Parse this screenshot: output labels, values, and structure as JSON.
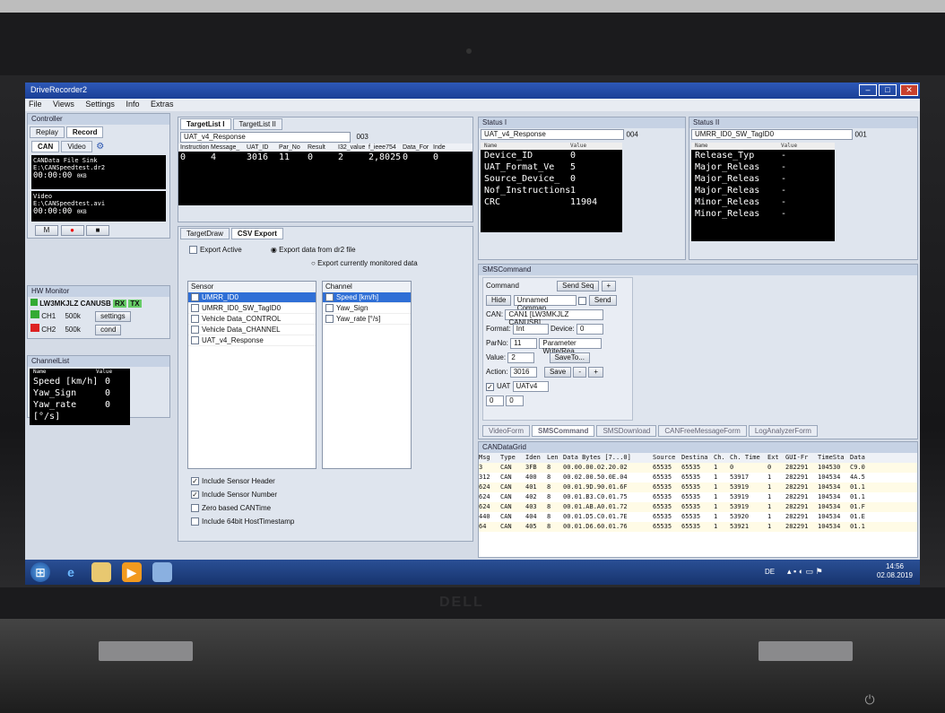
{
  "window": {
    "title": "DriveRecorder2",
    "menu": [
      "File",
      "Views",
      "Settings",
      "Info",
      "Extras"
    ]
  },
  "controller": {
    "header": "Controller",
    "tabs": [
      "Replay",
      "Record"
    ],
    "subtabs": [
      "CAN",
      "Video"
    ],
    "can_file": "CANData File Sink",
    "can_path": "E:\\CANSpeedtest.dr2",
    "can_time": "00:00:00",
    "can_size": "0KB",
    "video_label": "Video",
    "video_path": "E:\\CANSpeedtest.avi",
    "video_time": "00:00:00",
    "video_size": "0KB",
    "toggle_label": "on",
    "mark_label": "M"
  },
  "hw_monitor": {
    "header": "HW Monitor",
    "device": "LW3MKJLZ CANUSB",
    "rx": "RX",
    "tx": "TX",
    "channels": [
      {
        "name": "CH1",
        "rate": "500k",
        "btn": "settings"
      },
      {
        "name": "CH2",
        "rate": "500k",
        "btn": "cond"
      }
    ]
  },
  "channel_list": {
    "header": "ChannelList",
    "col_name": "Name",
    "col_value": "Value",
    "rows": [
      {
        "name": "Speed [km/h]",
        "value": "0"
      },
      {
        "name": "Yaw_Sign",
        "value": "0"
      },
      {
        "name": "Yaw_rate [°/s]",
        "value": "0"
      }
    ]
  },
  "targetlist": {
    "tabs": [
      "TargetList I",
      "TargetList II"
    ],
    "selector": "UAT_v4_Response",
    "count": "003",
    "columns": [
      "Instruction",
      "Message_",
      "UAT_ID",
      "Par_No",
      "Result",
      "I32_value",
      "f_ieee754",
      "Data_For",
      "Inde"
    ],
    "row": [
      "0",
      "4",
      "3016",
      "11",
      "0",
      "2",
      "2,8025",
      "0",
      "0"
    ]
  },
  "lower_tabs": {
    "tabs": [
      "TargetDraw",
      "CSV Export"
    ],
    "export_active": "Export Active",
    "radio1": "Export data from dr2 file",
    "radio2": "Export currently monitored data",
    "sensor_header": "Sensor",
    "channel_header": "Channel",
    "sensors": [
      "UMRR_ID0",
      "UMRR_ID0_SW_TagID0",
      "Vehicle Data_CONTROL",
      "Vehicle Data_CHANNEL",
      "UAT_v4_Response"
    ],
    "channels": [
      "Speed [km/h]",
      "Yaw_Sign",
      "Yaw_rate [°/s]"
    ],
    "options": [
      "Include Sensor Header",
      "Include Sensor Number",
      "Zero based CANTime",
      "Include 64bit HostTimestamp"
    ]
  },
  "status1": {
    "header": "Status I",
    "selector": "UAT_v4_Response",
    "count": "004",
    "col_name": "Name",
    "col_value": "Value",
    "rows": [
      {
        "name": "Device_ID",
        "value": "0"
      },
      {
        "name": "UAT_Format_Ve",
        "value": "5"
      },
      {
        "name": "Source_Device_",
        "value": "0"
      },
      {
        "name": "Nof_Instructions",
        "value": "1"
      },
      {
        "name": "CRC",
        "value": "11904"
      }
    ]
  },
  "status2": {
    "header": "Status II",
    "selector": "UMRR_ID0_SW_TagID0",
    "count": "001",
    "col_name": "Name",
    "col_value": "Value",
    "rows": [
      {
        "name": "Release_Typ",
        "value": "-"
      },
      {
        "name": "Major_Releas",
        "value": "-"
      },
      {
        "name": "Major_Releas",
        "value": "-"
      },
      {
        "name": "Major_Releas",
        "value": "-"
      },
      {
        "name": "Minor_Releas",
        "value": "-"
      },
      {
        "name": "Minor_Releas",
        "value": "-"
      }
    ]
  },
  "sms": {
    "header": "SMSCommand",
    "command_label": "Command",
    "send_seq": "Send Seq",
    "plus": "+",
    "hide": "Hide",
    "unnamed": "Unnamed Comman",
    "send": "Send",
    "can_label": "CAN:",
    "can_value": "CAN1 [LW3MKJLZ CANUSB]",
    "format_label": "Format:",
    "format_value": "Int",
    "device_label": "Device:",
    "device_value": "0",
    "parno_label": "ParNo:",
    "parno_value": "11",
    "param_sel": "Parameter Write/Rea",
    "value_label": "Value:",
    "value_value": "2",
    "saveto": "SaveTo...",
    "action_label": "Action:",
    "action_value": "3016",
    "save": "Save",
    "minus": "-",
    "uat_label": "UAT",
    "uat_value": "UATv4",
    "idx_a": "0",
    "idx_b": "0",
    "bottom_tabs": [
      "VideoForm",
      "SMSCommand",
      "SMSDownload",
      "CANFreeMessageForm",
      "LogAnalyzerForm"
    ]
  },
  "grid": {
    "header": "CANDataGrid",
    "columns": [
      "Msg",
      "Type",
      "Iden",
      "Len",
      "Data Bytes [7...0]",
      "Source",
      "Destina",
      "Ch.",
      "Ch. Time",
      "Ext",
      "GUI-Fr",
      "TimeSta",
      "Data"
    ],
    "rows": [
      [
        "3",
        "CAN",
        "3FB",
        "8",
        "00.00.00.02.20.02",
        "65535",
        "65535",
        "1",
        "0",
        "0",
        "282291",
        "104530",
        "C9.0"
      ],
      [
        "312",
        "CAN",
        "400",
        "8",
        "00.02.00.50.0E.04",
        "65535",
        "65535",
        "1",
        "53917",
        "1",
        "282291",
        "104534",
        "4A.5"
      ],
      [
        "624",
        "CAN",
        "401",
        "8",
        "00.01.9D.90.01.6F",
        "65535",
        "65535",
        "1",
        "53919",
        "1",
        "282291",
        "104534",
        "01.1"
      ],
      [
        "624",
        "CAN",
        "402",
        "8",
        "00.01.B3.C0.01.75",
        "65535",
        "65535",
        "1",
        "53919",
        "1",
        "282291",
        "104534",
        "01.1"
      ],
      [
        "624",
        "CAN",
        "403",
        "8",
        "00.01.AB.A0.01.72",
        "65535",
        "65535",
        "1",
        "53919",
        "1",
        "282291",
        "104534",
        "01.F"
      ],
      [
        "440",
        "CAN",
        "404",
        "8",
        "00.01.D5.C0.01.7E",
        "65535",
        "65535",
        "1",
        "53920",
        "1",
        "282291",
        "104534",
        "01.E"
      ],
      [
        "64",
        "CAN",
        "405",
        "8",
        "00.01.D6.60.01.76",
        "65535",
        "65535",
        "1",
        "53921",
        "1",
        "282291",
        "104534",
        "01.1"
      ]
    ]
  },
  "taskbar": {
    "lang": "DE",
    "time": "14:56",
    "date": "02.08.2019"
  },
  "laptop": {
    "brand": "DELL"
  }
}
